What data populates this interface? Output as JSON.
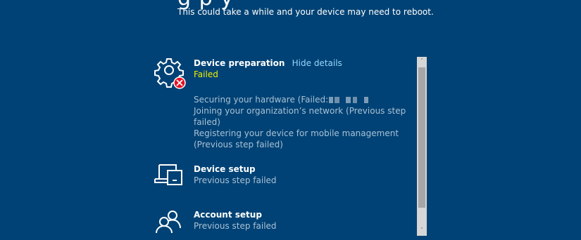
{
  "header": {
    "title_partial": "g  p  y",
    "subtitle": "This could take a while and your device may need to reboot."
  },
  "steps": [
    {
      "title": "Device preparation",
      "link": "Hide details",
      "status": "Failed",
      "details": [
        "Securing your hardware (Failed:",
        "Joining your organization’s network (Previous step failed)",
        "Registering your device for mobile management (Previous step failed)"
      ],
      "icon": "gear-icon"
    },
    {
      "title": "Device setup",
      "status": "Previous step failed",
      "icon": "devices-icon"
    },
    {
      "title": "Account setup",
      "status": "Previous step failed",
      "icon": "users-icon"
    }
  ],
  "colors": {
    "background": "#004275",
    "failed": "#f0f000",
    "link": "#99d6ff",
    "muted": "#a9c1d6",
    "error_badge": "#e81123"
  }
}
